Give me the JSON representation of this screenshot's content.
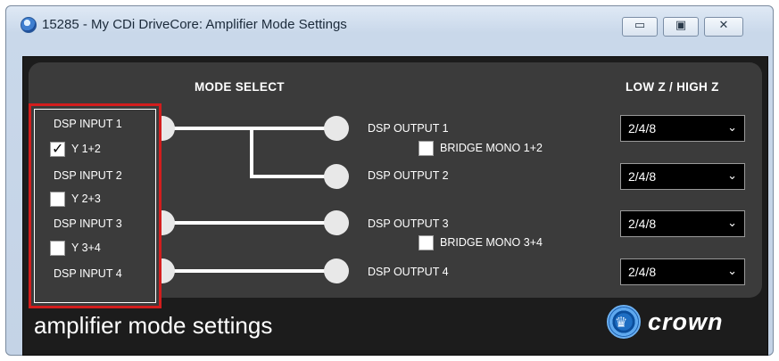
{
  "window": {
    "title": "15285 - My CDi DriveCore: Amplifier Mode Settings",
    "controls": {
      "minimize": "▭",
      "maximize": "▣",
      "close": "✕"
    }
  },
  "headers": {
    "mode_select": "MODE SELECT",
    "impedance": "LOW Z / HIGH Z"
  },
  "inputs": [
    "DSP INPUT 1",
    "DSP INPUT 2",
    "DSP INPUT 3",
    "DSP INPUT 4"
  ],
  "y_options": [
    {
      "label": "Y 1+2",
      "checked": true
    },
    {
      "label": "Y 2+3",
      "checked": false
    },
    {
      "label": "Y 3+4",
      "checked": false
    }
  ],
  "outputs": [
    "DSP OUTPUT 1",
    "DSP OUTPUT 2",
    "DSP OUTPUT 3",
    "DSP OUTPUT 4"
  ],
  "bridge": [
    {
      "label": "BRIDGE MONO 1+2",
      "checked": false
    },
    {
      "label": "BRIDGE MONO 3+4",
      "checked": false
    }
  ],
  "impedance_values": [
    "2/4/8",
    "2/4/8",
    "2/4/8",
    "2/4/8"
  ],
  "footer": {
    "title": "amplifier mode settings",
    "brand": "crown"
  },
  "colors": {
    "panel": "#1c1c1c",
    "inner": "#3b3b3b",
    "highlight": "#d31d1d",
    "brand_blue": "#1e6ec3"
  }
}
